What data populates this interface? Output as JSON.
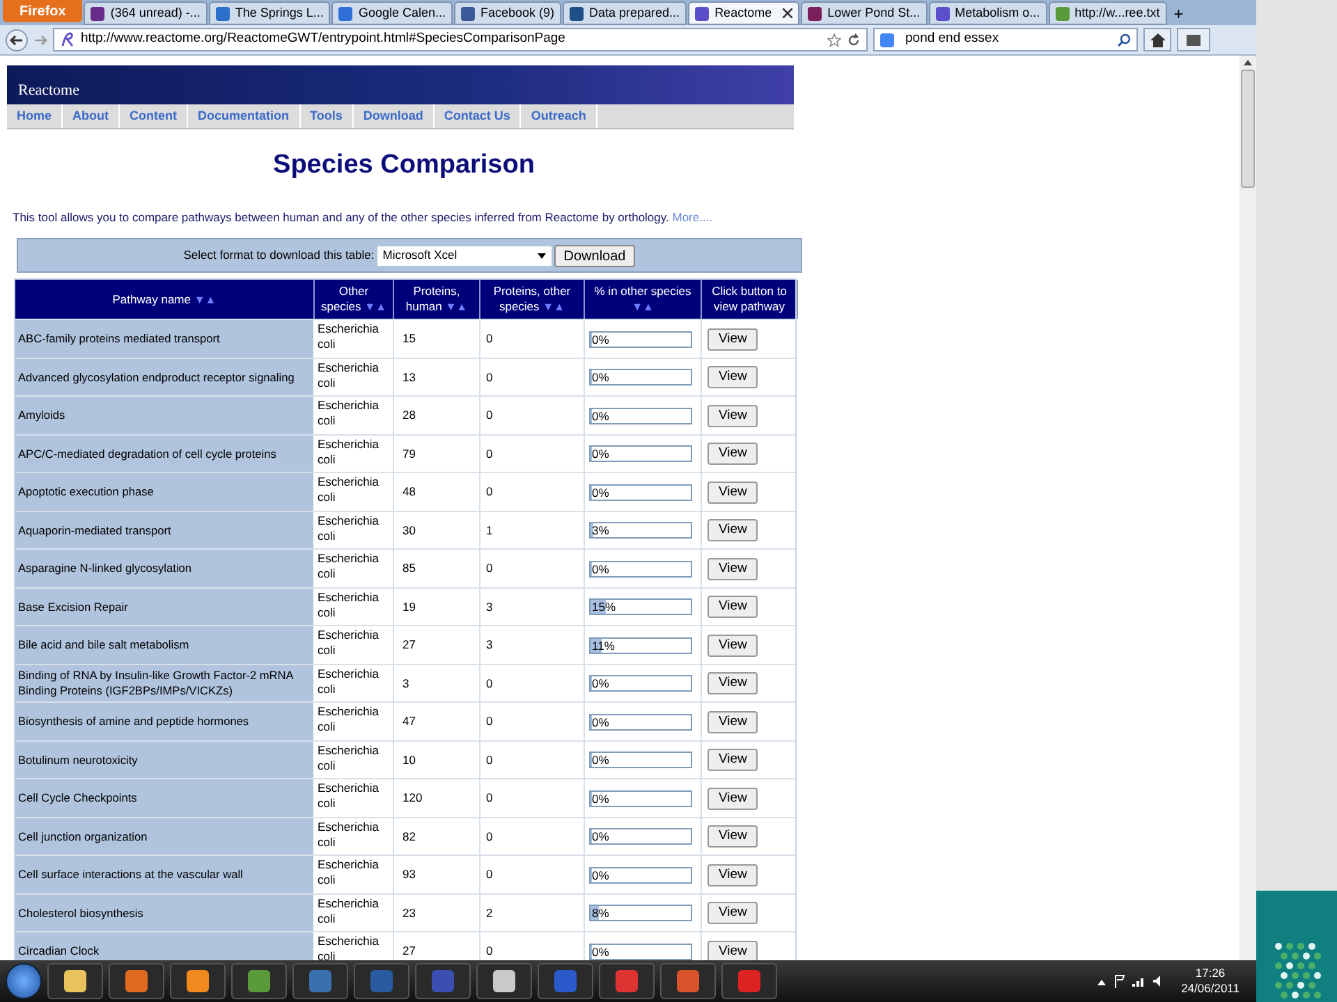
{
  "browser": {
    "menu_button": "Firefox",
    "tabs": [
      {
        "title": "(364 unread) -...",
        "selected": false,
        "color": "#6a2c8a"
      },
      {
        "title": "The Springs L...",
        "selected": false,
        "color": "#2a6fc9"
      },
      {
        "title": "Google Calen...",
        "selected": false,
        "color": "#2f6fd6"
      },
      {
        "title": "Facebook (9)",
        "selected": false,
        "color": "#3b5998"
      },
      {
        "title": "Data prepared...",
        "selected": false,
        "color": "#1d4f86"
      },
      {
        "title": "Reactome",
        "selected": true,
        "color": "#5a4fc9"
      },
      {
        "title": "Lower Pond St...",
        "selected": false,
        "color": "#7b1f5a"
      },
      {
        "title": "Metabolism o...",
        "selected": false,
        "color": "#5a4fc9"
      },
      {
        "title": "http://w...ree.txt",
        "selected": false,
        "color": "#5a9a3a"
      }
    ],
    "new_tab": "+",
    "address": "http://www.reactome.org/ReactomeGWT/entrypoint.html#SpeciesComparisonPage",
    "search": "pond end essex"
  },
  "site": {
    "logo": "Reactome",
    "nav": [
      "Home",
      "About",
      "Content",
      "Documentation",
      "Tools",
      "Download",
      "Contact Us",
      "Outreach"
    ],
    "title": "Species Comparison",
    "intro": "This tool allows you to compare pathways between human and any of the other species inferred from Reactome by orthology.",
    "more_link": "More....",
    "download_label": "Select format to download this table:",
    "format": "Microsoft Xcel",
    "download_button": "Download",
    "sort_icon": "▼▲",
    "columns": [
      "Pathway name",
      "Other species",
      "Proteins, human",
      "Proteins, other species",
      "% in other species",
      "Click button to view pathway"
    ],
    "rows": [
      {
        "pathway": "ABC-family proteins mediated transport",
        "species": "Escherichia coli",
        "human": "15",
        "other": "0",
        "percent": "0%",
        "level": 0,
        "view": "View"
      },
      {
        "pathway": "Advanced glycosylation endproduct receptor signaling",
        "species": "Escherichia coli",
        "human": "13",
        "other": "0",
        "percent": "0%",
        "level": 0,
        "view": "View"
      },
      {
        "pathway": "Amyloids",
        "species": "Escherichia coli",
        "human": "28",
        "other": "0",
        "percent": "0%",
        "level": 0,
        "view": "View"
      },
      {
        "pathway": "APC/C-mediated degradation of cell cycle proteins",
        "species": "Escherichia coli",
        "human": "79",
        "other": "0",
        "percent": "0%",
        "level": 0,
        "view": "View"
      },
      {
        "pathway": "Apoptotic execution phase",
        "species": "Escherichia coli",
        "human": "48",
        "other": "0",
        "percent": "0%",
        "level": 0,
        "view": "View"
      },
      {
        "pathway": "Aquaporin-mediated transport",
        "species": "Escherichia coli",
        "human": "30",
        "other": "1",
        "percent": "3%",
        "level": 0.03,
        "view": "View"
      },
      {
        "pathway": "Asparagine N-linked glycosylation",
        "species": "Escherichia coli",
        "human": "85",
        "other": "0",
        "percent": "0%",
        "level": 0,
        "view": "View"
      },
      {
        "pathway": "Base Excision Repair",
        "species": "Escherichia coli",
        "human": "19",
        "other": "3",
        "percent": "15%",
        "level": 0.15,
        "view": "View"
      },
      {
        "pathway": "Bile acid and bile salt metabolism",
        "species": "Escherichia coli",
        "human": "27",
        "other": "3",
        "percent": "11%",
        "level": 0.11,
        "view": "View"
      },
      {
        "pathway": "Binding of RNA by Insulin-like Growth Factor-2 mRNA Binding Proteins (IGF2BPs/IMPs/VICKZs)",
        "species": "Escherichia coli",
        "human": "3",
        "other": "0",
        "percent": "0%",
        "level": 0,
        "view": "View"
      },
      {
        "pathway": "Biosynthesis of amine and peptide hormones",
        "species": "Escherichia coli",
        "human": "47",
        "other": "0",
        "percent": "0%",
        "level": 0,
        "view": "View"
      },
      {
        "pathway": "Botulinum neurotoxicity",
        "species": "Escherichia coli",
        "human": "10",
        "other": "0",
        "percent": "0%",
        "level": 0,
        "view": "View"
      },
      {
        "pathway": "Cell Cycle Checkpoints",
        "species": "Escherichia coli",
        "human": "120",
        "other": "0",
        "percent": "0%",
        "level": 0,
        "view": "View"
      },
      {
        "pathway": "Cell junction organization",
        "species": "Escherichia coli",
        "human": "82",
        "other": "0",
        "percent": "0%",
        "level": 0,
        "view": "View"
      },
      {
        "pathway": "Cell surface interactions at the vascular wall",
        "species": "Escherichia coli",
        "human": "93",
        "other": "0",
        "percent": "0%",
        "level": 0,
        "view": "View"
      },
      {
        "pathway": "Cholesterol biosynthesis",
        "species": "Escherichia coli",
        "human": "23",
        "other": "2",
        "percent": "8%",
        "level": 0.08,
        "view": "View"
      },
      {
        "pathway": "Circadian Clock",
        "species": "Escherichia coli",
        "human": "27",
        "other": "0",
        "percent": "0%",
        "level": 0,
        "view": "View"
      }
    ]
  },
  "taskbar": {
    "time": "17:26",
    "date": "24/06/2011"
  }
}
